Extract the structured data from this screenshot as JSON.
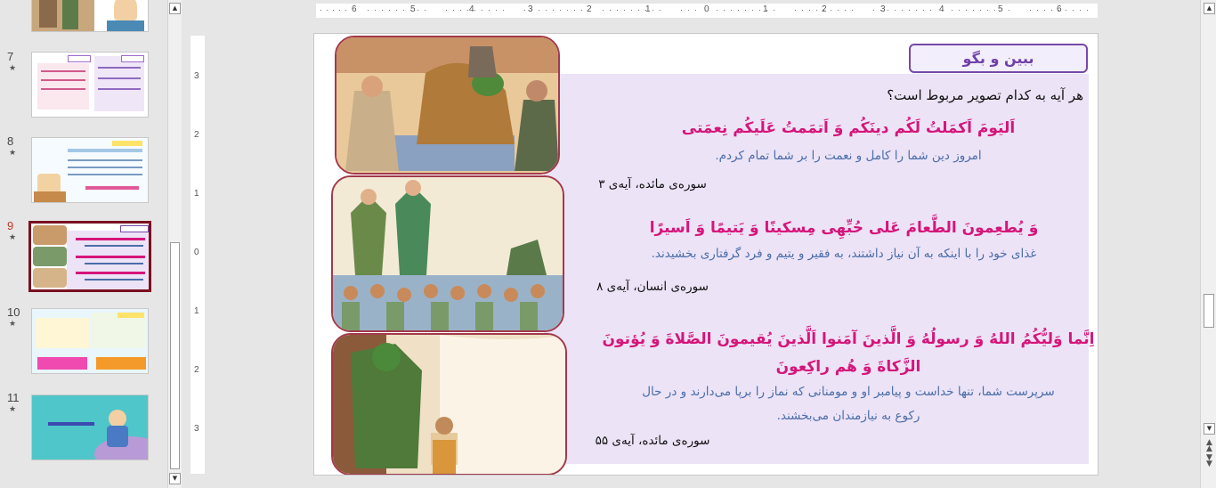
{
  "thumbnails": [
    {
      "number": "",
      "star": ""
    },
    {
      "number": "7",
      "star": "★"
    },
    {
      "number": "8",
      "star": "★"
    },
    {
      "number": "9",
      "star": "★"
    },
    {
      "number": "10",
      "star": "★"
    },
    {
      "number": "11",
      "star": "★"
    }
  ],
  "ruler": {
    "top": [
      "6",
      "5",
      "4",
      "3",
      "2",
      "1",
      "0",
      "1",
      "2",
      "3",
      "4",
      "5",
      "6"
    ],
    "left": [
      "3",
      "2",
      "1",
      "0",
      "1",
      "2",
      "3"
    ]
  },
  "slide": {
    "title": "ببین و بگو",
    "question": "هر آیه به کدام تصویر مربوط است؟",
    "verses": [
      {
        "arabic": "اَلیَومَ اَکمَلتُ لَکُم دینَکُم وَ اَتمَمتُ عَلَیکُم نِعمَتی",
        "translation": "امروز دین شما را کامل و نعمت را بر شما تمام کردم.",
        "reference": "سوره‌ی مائده، آیه‌ی ۳"
      },
      {
        "arabic": "وَ یُطعِمونَ الطَّعامَ عَلی حُبِّهِی مِسکینًا وَ یَتیمًا وَ اَسیرًا",
        "translation": "غذای خود را با اینکه به آن نیاز داشتند، به فقیر و یتیم و فرد گرفتاری بخشیدند.",
        "reference": "سوره‌ی انسان، آیه‌ی ۸"
      },
      {
        "arabic_line1": "اِنَّما وَلیُّکُمُ اللهُ وَ رسولُهُ وَ الَّذینَ آمَنوا اَلَّذینَ یُقیمونَ الصَّلاةَ وَ یُؤتونَ",
        "arabic_line2": "الزَّکاةَ وَ هُم راکِعونَ",
        "translation_line1": "سرپرست شما، تنها خداست و پیامبر او و مومنانی که نماز را برپا می‌دارند و در حال",
        "translation_line2": "رکوع به نیازمندان می‌بخشند.",
        "reference": "سوره‌ی مائده، آیه‌ی ۵۵"
      }
    ]
  },
  "colors": {
    "accent": "#d6157a",
    "translation": "#4a6da8",
    "title": "#7040a8",
    "panel": "#ece3f7",
    "active_thumb_border": "#7a1020"
  }
}
